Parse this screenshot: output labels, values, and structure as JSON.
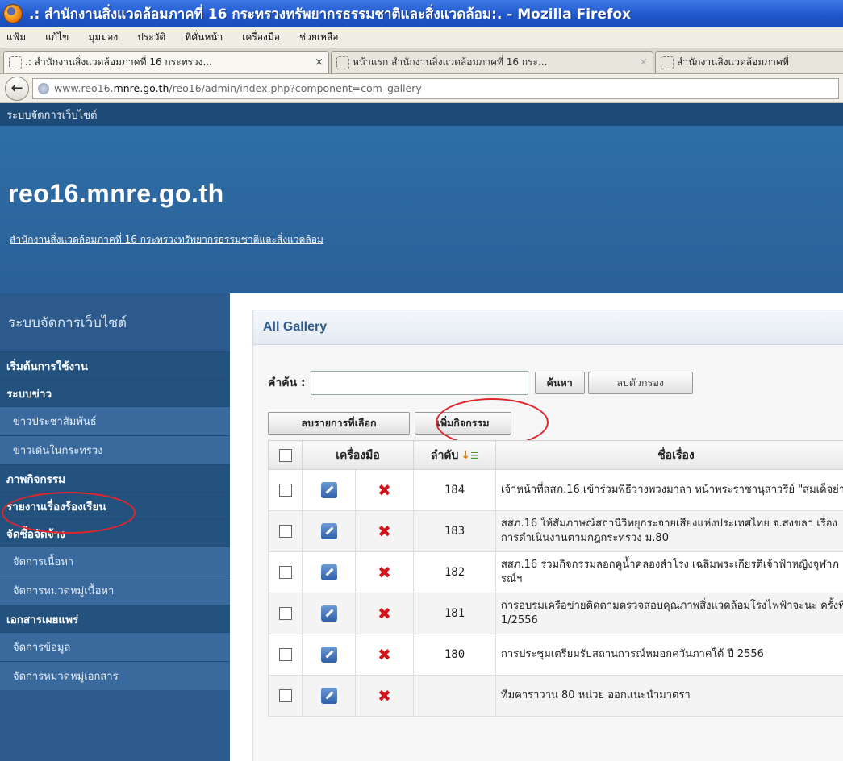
{
  "window": {
    "title": ".: สำนักงานสิ่งแวดล้อมภาคที่ 16 กระทรวงทรัพยากรธรรมชาติและสิ่งแวดล้อม:. - Mozilla Firefox"
  },
  "menu": [
    {
      "label": "แฟ้ม",
      "key": "file"
    },
    {
      "label": "แก้ไข",
      "key": "edit"
    },
    {
      "label": "มุมมอง",
      "key": "view"
    },
    {
      "label": "ประวัติ",
      "key": "history"
    },
    {
      "label": "ที่คั่นหน้า",
      "key": "bookmarks"
    },
    {
      "label": "เครื่องมือ",
      "key": "tools"
    },
    {
      "label": "ช่วยเหลือ",
      "key": "help"
    }
  ],
  "tabs": [
    {
      "label": ".: สำนักงานสิ่งแวดล้อมภาคที่ 16 กระทรวง...",
      "close": "×"
    },
    {
      "label": "หน้าแรก สำนักงานสิ่งแวดล้อมภาคที่ 16 กระ...",
      "close": "×"
    },
    {
      "label": "สำนักงานสิ่งแวดล้อมภาคที่"
    }
  ],
  "address": {
    "prefix": "www.reo16.",
    "domain": "mnre.go.th",
    "path": "/reo16/admin/index.php?component=com_gallery"
  },
  "site": {
    "topbar": "ระบบจัดการเว็บไซต์",
    "name": "reo16.mnre.go.th",
    "tagline": "สำนักงานสิ่งแวดล้อมภาคที่ 16 กระทรวงทรัพยากรธรรมชาติและสิ่งแวดล้อม"
  },
  "sidebar": {
    "title": "ระบบจัดการเว็บไซต์",
    "items": [
      {
        "label": "เริ่มต้นการใช้งาน",
        "type": "group"
      },
      {
        "label": "ระบบข่าว",
        "type": "group"
      },
      {
        "label": "ข่าวประชาสัมพันธ์",
        "type": "sub"
      },
      {
        "label": "ข่าวเด่นในกระทรวง",
        "type": "sub"
      },
      {
        "label": "ภาพกิจกรรม",
        "type": "group"
      },
      {
        "label": "รายงานเรื่องร้องเรียน",
        "type": "group"
      },
      {
        "label": "จัดซื้อจัดจ้าง",
        "type": "group"
      },
      {
        "label": "จัดการเนื้อหา",
        "type": "sub"
      },
      {
        "label": "จัดการหมวดหมู่เนื้อหา",
        "type": "sub"
      },
      {
        "label": "เอกสารเผยแพร่",
        "type": "group"
      },
      {
        "label": "จัดการข้อมูล",
        "type": "sub"
      },
      {
        "label": "จัดการหมวดหมู่เอกสาร",
        "type": "sub"
      }
    ]
  },
  "gallery": {
    "heading": "All Gallery",
    "search_label": "คำค้น :",
    "search_value": "",
    "search_button": "ค้นหา",
    "clear_button": "ลบตัวกรอง",
    "delete_selected_button": "ลบรายการที่เลือก",
    "add_activity_button": "เพิ่มกิจกรรม",
    "columns": {
      "tools": "เครื่องมือ",
      "order": "ลำดับ",
      "title": "ชื่อเรื่อง"
    },
    "rows": [
      {
        "order": "184",
        "title": "เจ้าหน้าที่สสภ.16 เข้าร่วมพิธีวางพวงมาลา หน้าพระราชานุสาวรีย์ \"สมเด็จย่า\""
      },
      {
        "order": "183",
        "title": "สสภ.16 ให้สัมภาษณ์สถานีวิทยุกระจายเสียงแห่งประเทศไทย จ.สงขลา เรื่องการดำเนินงานตามกฎกระทรวง ม.80"
      },
      {
        "order": "182",
        "title": "สสภ.16 ร่วมกิจกรรมลอกคูน้ำคลองสำโรง เฉลิมพระเกียรติเจ้าฟ้าหญิงจุฬาภรณ์ฯ"
      },
      {
        "order": "181",
        "title": "การอบรมเครือข่ายติดตามตรวจสอบคุณภาพสิ่งแวดล้อมโรงไฟฟ้าจะนะ ครั้งที่ 1/2556"
      },
      {
        "order": "180",
        "title": "การประชุมเตรียมรับสถานการณ์หมอกควันภาคใต้ ปี 2556"
      },
      {
        "order": "",
        "title": "ทีมคาราวาน 80 หน่วย ออกแนะนำมาตรา"
      }
    ]
  },
  "icons": {
    "edit": "edit-icon",
    "delete": "delete-icon",
    "sort": "sort-icon",
    "back": "back-arrow-icon"
  },
  "colors": {
    "titlebar": "#1f55c8",
    "site_header": "#2f6ea6",
    "sidebar": "#2c5a8c",
    "heading_text": "#2f5b8d",
    "delete_red": "#d3141b",
    "annotation_circle": "#e0262b"
  }
}
